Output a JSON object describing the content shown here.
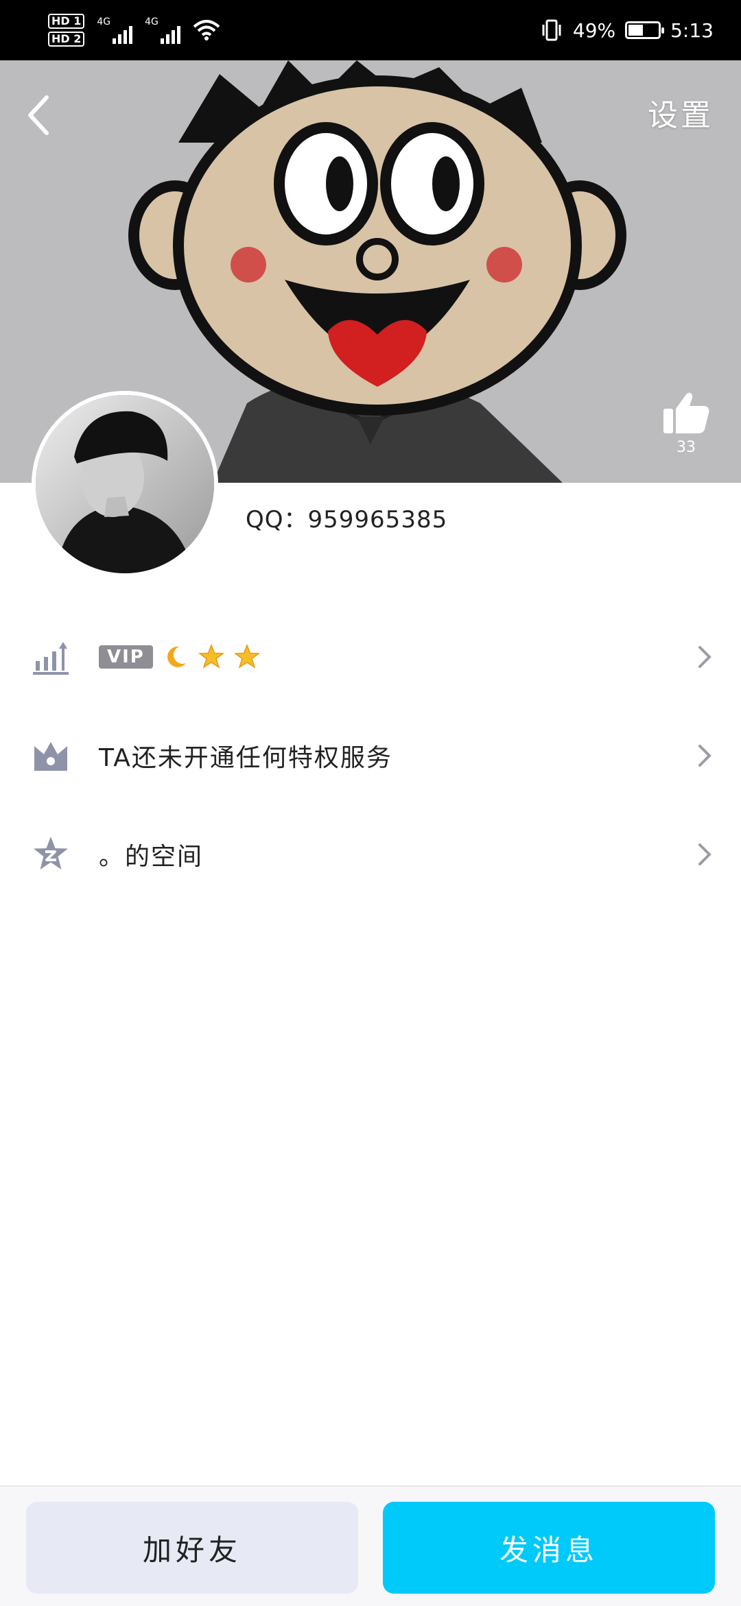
{
  "status_bar": {
    "hd_labels": [
      "HD 1",
      "HD 2"
    ],
    "net_1": "4G",
    "net_2": "4G",
    "battery_percent_text": "49%",
    "battery_level": 0.49,
    "time": "5:13"
  },
  "header": {
    "settings_label": "设置",
    "like_count": "33"
  },
  "profile": {
    "qq_line": "QQ：959965385"
  },
  "menu": {
    "vip_badge": "VIP",
    "privilege_text": "TA还未开通任何特权服务",
    "space_text": "。的空间"
  },
  "bottom": {
    "add_friend_label": "加好友",
    "send_message_label": "发消息"
  },
  "colors": {
    "primary_button": "#00caf9",
    "secondary_button": "#e7eaf5",
    "icon_gray": "#8e93a8",
    "cheek_red": "#cf3b3b",
    "mouth_red": "#d21f1f"
  }
}
